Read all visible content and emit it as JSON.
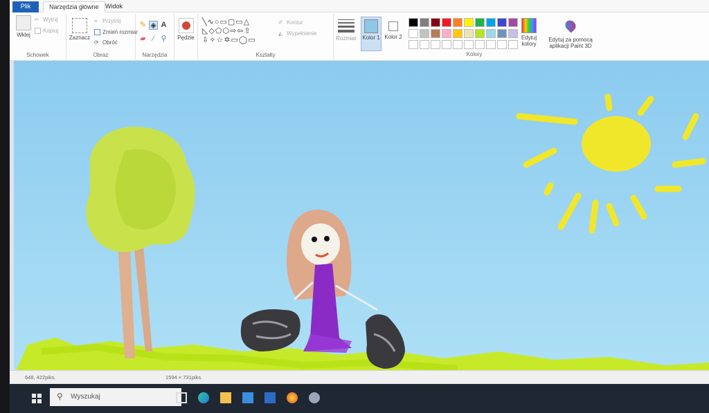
{
  "tabs": {
    "file": "Plik",
    "home": "Narzędzia główne",
    "view": "Widok"
  },
  "clipboard": {
    "paste": "Wklej",
    "cut": "Wytnij",
    "copy": "Kopiuj",
    "label": "Schowek"
  },
  "image": {
    "select": "Zaznacz",
    "crop": "Przytnij",
    "resize": "Zmień rozmiar",
    "rotate": "Obróć",
    "label": "Obraz"
  },
  "tools": {
    "label": "Narzędzia",
    "text_tool": "A"
  },
  "brushes": {
    "label": "Pędzle"
  },
  "shapes": {
    "label": "Kształty",
    "outline": "Kontur",
    "fill": "Wypełnienie"
  },
  "size": {
    "label": "Rozmiar"
  },
  "colors": {
    "color1": "Kolor 1",
    "color2": "Kolor 2",
    "label": "Kolory",
    "edit_colors": "Edytuj kolory",
    "paint3d": "Edytuj za pomocą aplikacji Paint 3D",
    "color1_value": "#8fc7e6",
    "color2_value": "#ffffff",
    "palette_row1": [
      "#000000",
      "#7f7f7f",
      "#880015",
      "#ed1c24",
      "#ff7f27",
      "#fff200",
      "#22b14c",
      "#00a2e8",
      "#3f48cc",
      "#a349a4"
    ],
    "palette_row2": [
      "#ffffff",
      "#c3c3c3",
      "#b97a57",
      "#ffaec9",
      "#ffc90e",
      "#efe4b0",
      "#b5e61d",
      "#99d9ea",
      "#7092be",
      "#c8bfe7"
    ]
  },
  "status": {
    "cursor_pos": "648, 422piks.",
    "canvas_size": "1594 × 731piks."
  },
  "taskbar": {
    "search_placeholder": "Wyszukaj"
  }
}
